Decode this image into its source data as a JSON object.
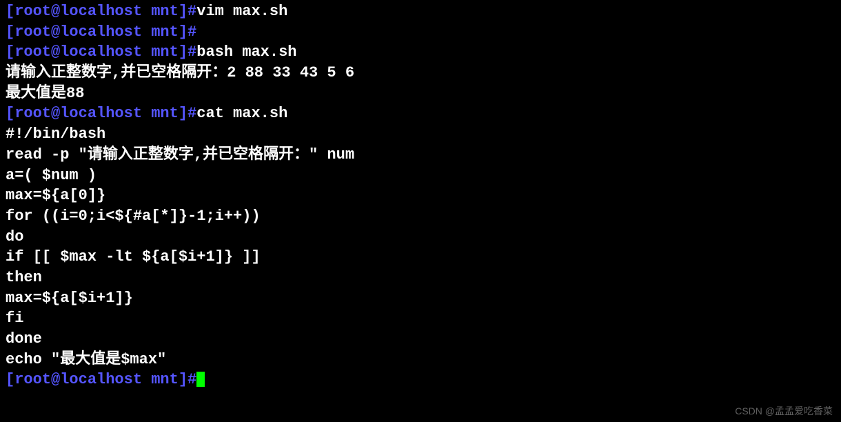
{
  "prompt": "[root@localhost mnt]#",
  "lines": {
    "cmd1": "vim max.sh",
    "cmd2": "",
    "cmd3": "bash max.sh",
    "out3a": "请输入正整数字,并已空格隔开：2 88 33 43 5 6",
    "out3b": "最大值是88",
    "cmd4": "cat max.sh",
    "script": {
      "l1": "#!/bin/bash",
      "l2": "read -p \"请输入正整数字,并已空格隔开：\" num",
      "l3": "a=( $num )",
      "l4": "",
      "l5": "max=${a[0]}",
      "l6": "for ((i=0;i<${#a[*]}-1;i++))",
      "l7": "do",
      "l8": "if [[ $max -lt ${a[$i+1]} ]]",
      "l9": "then",
      "l10": "max=${a[$i+1]}",
      "l11": "fi",
      "l12": "done",
      "l13": "echo \"最大值是$max\""
    }
  },
  "watermark": "CSDN @孟孟爱吃香菜"
}
